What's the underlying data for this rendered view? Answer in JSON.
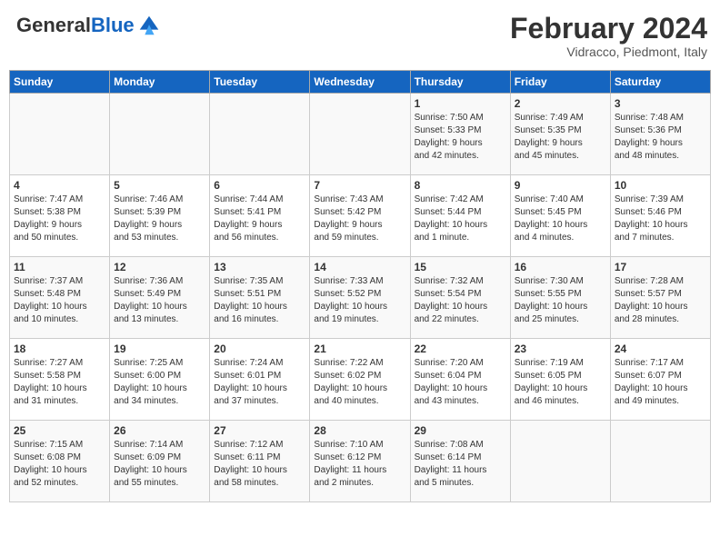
{
  "header": {
    "logo_general": "General",
    "logo_blue": "Blue",
    "main_title": "February 2024",
    "subtitle": "Vidracco, Piedmont, Italy"
  },
  "days_of_week": [
    "Sunday",
    "Monday",
    "Tuesday",
    "Wednesday",
    "Thursday",
    "Friday",
    "Saturday"
  ],
  "weeks": [
    [
      {
        "day": "",
        "info": ""
      },
      {
        "day": "",
        "info": ""
      },
      {
        "day": "",
        "info": ""
      },
      {
        "day": "",
        "info": ""
      },
      {
        "day": "1",
        "info": "Sunrise: 7:50 AM\nSunset: 5:33 PM\nDaylight: 9 hours\nand 42 minutes."
      },
      {
        "day": "2",
        "info": "Sunrise: 7:49 AM\nSunset: 5:35 PM\nDaylight: 9 hours\nand 45 minutes."
      },
      {
        "day": "3",
        "info": "Sunrise: 7:48 AM\nSunset: 5:36 PM\nDaylight: 9 hours\nand 48 minutes."
      }
    ],
    [
      {
        "day": "4",
        "info": "Sunrise: 7:47 AM\nSunset: 5:38 PM\nDaylight: 9 hours\nand 50 minutes."
      },
      {
        "day": "5",
        "info": "Sunrise: 7:46 AM\nSunset: 5:39 PM\nDaylight: 9 hours\nand 53 minutes."
      },
      {
        "day": "6",
        "info": "Sunrise: 7:44 AM\nSunset: 5:41 PM\nDaylight: 9 hours\nand 56 minutes."
      },
      {
        "day": "7",
        "info": "Sunrise: 7:43 AM\nSunset: 5:42 PM\nDaylight: 9 hours\nand 59 minutes."
      },
      {
        "day": "8",
        "info": "Sunrise: 7:42 AM\nSunset: 5:44 PM\nDaylight: 10 hours\nand 1 minute."
      },
      {
        "day": "9",
        "info": "Sunrise: 7:40 AM\nSunset: 5:45 PM\nDaylight: 10 hours\nand 4 minutes."
      },
      {
        "day": "10",
        "info": "Sunrise: 7:39 AM\nSunset: 5:46 PM\nDaylight: 10 hours\nand 7 minutes."
      }
    ],
    [
      {
        "day": "11",
        "info": "Sunrise: 7:37 AM\nSunset: 5:48 PM\nDaylight: 10 hours\nand 10 minutes."
      },
      {
        "day": "12",
        "info": "Sunrise: 7:36 AM\nSunset: 5:49 PM\nDaylight: 10 hours\nand 13 minutes."
      },
      {
        "day": "13",
        "info": "Sunrise: 7:35 AM\nSunset: 5:51 PM\nDaylight: 10 hours\nand 16 minutes."
      },
      {
        "day": "14",
        "info": "Sunrise: 7:33 AM\nSunset: 5:52 PM\nDaylight: 10 hours\nand 19 minutes."
      },
      {
        "day": "15",
        "info": "Sunrise: 7:32 AM\nSunset: 5:54 PM\nDaylight: 10 hours\nand 22 minutes."
      },
      {
        "day": "16",
        "info": "Sunrise: 7:30 AM\nSunset: 5:55 PM\nDaylight: 10 hours\nand 25 minutes."
      },
      {
        "day": "17",
        "info": "Sunrise: 7:28 AM\nSunset: 5:57 PM\nDaylight: 10 hours\nand 28 minutes."
      }
    ],
    [
      {
        "day": "18",
        "info": "Sunrise: 7:27 AM\nSunset: 5:58 PM\nDaylight: 10 hours\nand 31 minutes."
      },
      {
        "day": "19",
        "info": "Sunrise: 7:25 AM\nSunset: 6:00 PM\nDaylight: 10 hours\nand 34 minutes."
      },
      {
        "day": "20",
        "info": "Sunrise: 7:24 AM\nSunset: 6:01 PM\nDaylight: 10 hours\nand 37 minutes."
      },
      {
        "day": "21",
        "info": "Sunrise: 7:22 AM\nSunset: 6:02 PM\nDaylight: 10 hours\nand 40 minutes."
      },
      {
        "day": "22",
        "info": "Sunrise: 7:20 AM\nSunset: 6:04 PM\nDaylight: 10 hours\nand 43 minutes."
      },
      {
        "day": "23",
        "info": "Sunrise: 7:19 AM\nSunset: 6:05 PM\nDaylight: 10 hours\nand 46 minutes."
      },
      {
        "day": "24",
        "info": "Sunrise: 7:17 AM\nSunset: 6:07 PM\nDaylight: 10 hours\nand 49 minutes."
      }
    ],
    [
      {
        "day": "25",
        "info": "Sunrise: 7:15 AM\nSunset: 6:08 PM\nDaylight: 10 hours\nand 52 minutes."
      },
      {
        "day": "26",
        "info": "Sunrise: 7:14 AM\nSunset: 6:09 PM\nDaylight: 10 hours\nand 55 minutes."
      },
      {
        "day": "27",
        "info": "Sunrise: 7:12 AM\nSunset: 6:11 PM\nDaylight: 10 hours\nand 58 minutes."
      },
      {
        "day": "28",
        "info": "Sunrise: 7:10 AM\nSunset: 6:12 PM\nDaylight: 11 hours\nand 2 minutes."
      },
      {
        "day": "29",
        "info": "Sunrise: 7:08 AM\nSunset: 6:14 PM\nDaylight: 11 hours\nand 5 minutes."
      },
      {
        "day": "",
        "info": ""
      },
      {
        "day": "",
        "info": ""
      }
    ]
  ]
}
